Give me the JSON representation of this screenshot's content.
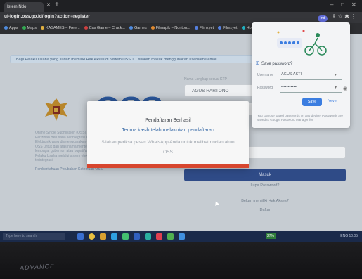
{
  "browser": {
    "tab_title": "Istem Ndo",
    "url": "ui-login.oss.go.id/login?action=register",
    "profile_initial": "Ind"
  },
  "bookmarks": [
    {
      "label": "Apps",
      "color": "#4f8ce0"
    },
    {
      "label": "Maps",
      "color": "#33a852"
    },
    {
      "label": "KASAMES – Free...",
      "color": "#e0b040"
    },
    {
      "label": "Cas Game – Crack...",
      "color": "#d04040"
    },
    {
      "label": "Games",
      "color": "#4f8ce0"
    },
    {
      "label": "Filmapik – Nonton...",
      "color": "#e08a30"
    },
    {
      "label": "Filmzyet",
      "color": "#5580e0"
    },
    {
      "label": "Filmzyet",
      "color": "#5580e0"
    },
    {
      "label": "Home – Canva",
      "color": "#20b0c0"
    }
  ],
  "page": {
    "info_bar": "Bagi Pelaku Usaha yang sudah memiliki Hak Akses di Sistem OSS 1.1 silakan masuk menggunakan username/email",
    "logo_text": "OSS",
    "left_text": "Online Single Submission (OSS) adalah Perizinan Berusaha Terintegrasi secara Elektronik yang diselenggarakan oleh Lembaga OSS untuk dan atas nama menteri, pimpinan lembaga, gubernur, atau bupati/wali kota kepada Pelaku Usaha melalui sistem elektronik yang terintegrasi.",
    "left_link": "Pemberitahuan Perubahan Ketentuan OSS",
    "name_label": "Nama Lengkap sesuai KTP",
    "name_value": "AGUS HARTONO",
    "login_button": "Masuk",
    "forgot_link": "Lupa Password?",
    "register_question": "Belum memiliki Hak Akses?",
    "register_link": "Daftar"
  },
  "modal": {
    "title": "Pendaftaran Berhasil",
    "subtitle": "Terima kasih telah melakukan pendaftaran",
    "body": "Silakan periksa pesan WhatsApp Anda untuk melihat rincian akun OSS"
  },
  "password_popup": {
    "title": "Save password?",
    "username_label": "Username",
    "username_value": "AGUS ASTI",
    "password_label": "Password",
    "password_value": "••••••••••••",
    "save_label": "Save",
    "never_label": "Never",
    "note": "You can use saved passwords on any device. Passwords are saved to Google Password Manager for"
  },
  "taskbar": {
    "search_placeholder": "Type here to search",
    "badge": "27%",
    "tray": "ENG 10:05"
  },
  "monitor_brand": "ADVANCE"
}
